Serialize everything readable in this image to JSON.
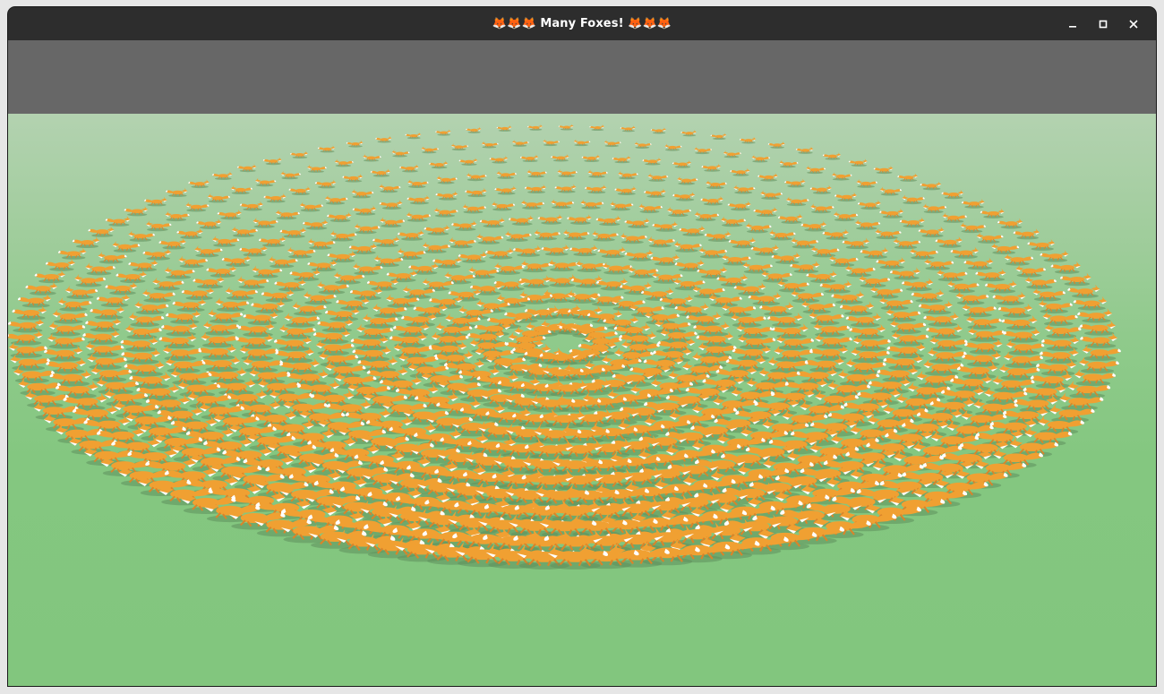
{
  "window": {
    "title": "🦊🦊🦊 Many Foxes! 🦊🦊🦊",
    "controls": {
      "minimize_icon": "minimize-icon",
      "maximize_icon": "maximize-icon",
      "close_icon": "close-icon"
    }
  },
  "scene": {
    "description_icon": "fox-sprite",
    "colors": {
      "clear": "#676767",
      "ground_far": "#b3d2b0",
      "ground_near": "#82c67e",
      "fox_body": "#f0a032",
      "fox_belly": "#ffffff",
      "shadow": "#5f8f5c"
    }
  }
}
